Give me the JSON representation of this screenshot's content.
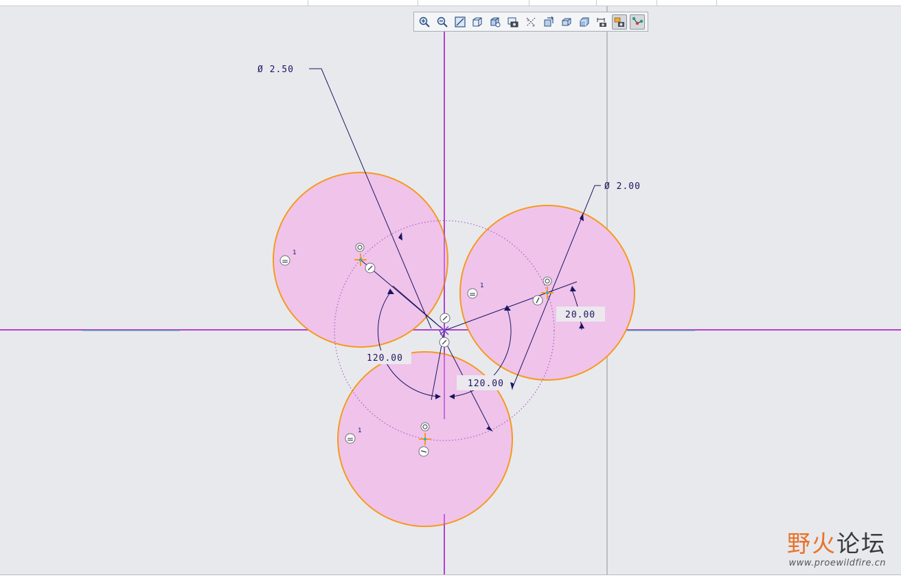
{
  "toolbar": {
    "buttons": [
      {
        "name": "zoom-in-icon",
        "active": false
      },
      {
        "name": "zoom-out-icon",
        "active": false
      },
      {
        "name": "refit-icon",
        "active": false
      },
      {
        "name": "display-style-icon",
        "active": false
      },
      {
        "name": "saved-orientations-icon",
        "active": false
      },
      {
        "name": "view-manager-icon",
        "active": false
      },
      {
        "name": "datum-display-icon",
        "active": false
      },
      {
        "name": "spin-center-icon",
        "active": false
      },
      {
        "name": "annotation-display-icon",
        "active": false
      },
      {
        "name": "sketch-view-icon",
        "active": false
      },
      {
        "name": "sketcher-display-icon",
        "active": false
      },
      {
        "name": "constraint-display-icon",
        "active": true
      },
      {
        "name": "vertex-display-icon",
        "active": true
      }
    ]
  },
  "sketch": {
    "dimensions": {
      "large_diameter": "Ø 2.50",
      "small_diameter": "Ø 2.00",
      "angle_offset": "20.00",
      "angle_left": "120.00",
      "angle_right": "120.00"
    },
    "equal_constraint_symbol": "=",
    "equal_constraint_index": "1"
  },
  "watermark": {
    "main_a": "野火",
    "main_b": "论坛",
    "url": "www.proewildfire.cn"
  },
  "colors": {
    "background": "#e8e9ed",
    "circle_fill": "#efc3ea",
    "circle_stroke": "#f59a1b",
    "centerline": "#b43fd1",
    "dimension": "#1a1560",
    "construction": "#a85bc7"
  }
}
